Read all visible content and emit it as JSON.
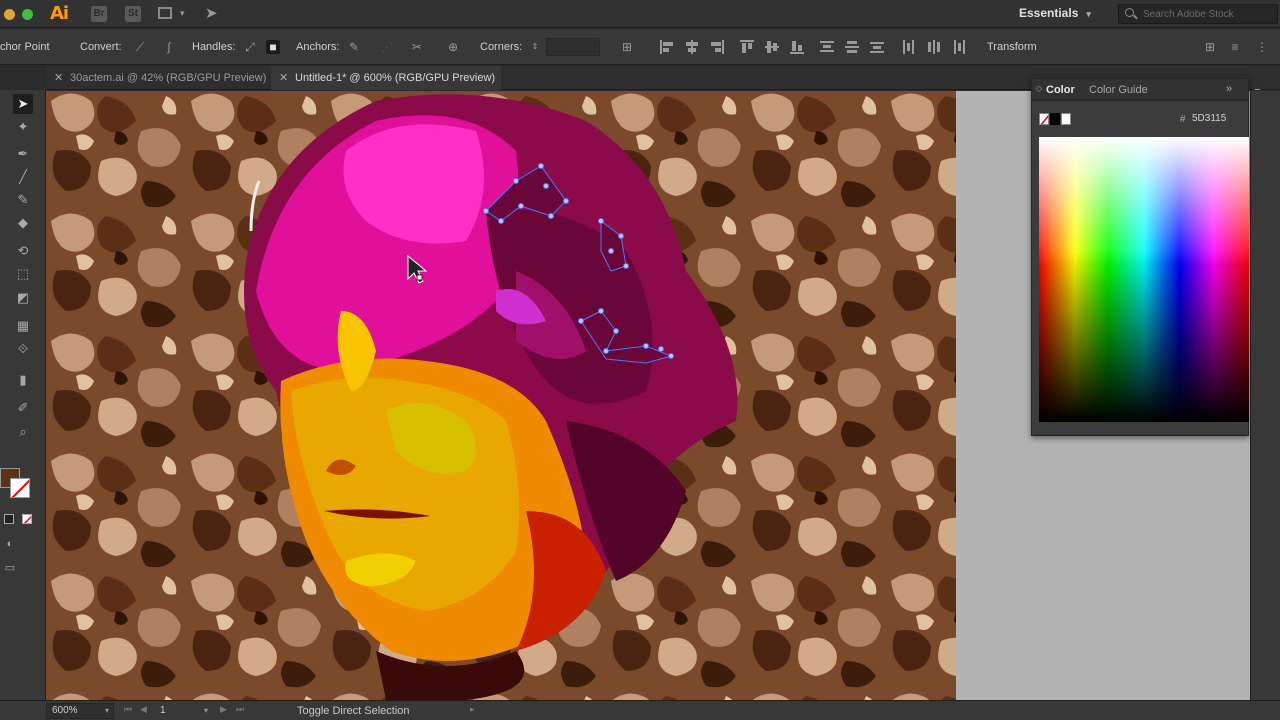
{
  "app": {
    "logo": "Ai",
    "bridge_label": "Br",
    "stock_label": "St",
    "workspace": "Essentials",
    "search_placeholder": "Search Adobe Stock"
  },
  "control_bar": {
    "anchor_point_label": "chor Point",
    "convert_label": "Convert:",
    "handles_label": "Handles:",
    "anchors_label": "Anchors:",
    "corners_label": "Corners:",
    "transform_label": "Transform"
  },
  "tabs": [
    {
      "label": "30actem.ai @ 42% (RGB/GPU Preview)",
      "active": false
    },
    {
      "label": "Untitled-1* @ 600% (RGB/GPU Preview)",
      "active": true
    }
  ],
  "color_panel": {
    "tab_color": "Color",
    "tab_color_guide": "Color Guide",
    "hex_symbol": "#",
    "hex_value": "5D3115"
  },
  "status_bar": {
    "zoom": "600%",
    "artboard": "1",
    "message": "Toggle Direct Selection"
  },
  "colors": {
    "accent": "#ff9a00",
    "fill_color": "#5D3115",
    "selection": "#4a78ff"
  }
}
